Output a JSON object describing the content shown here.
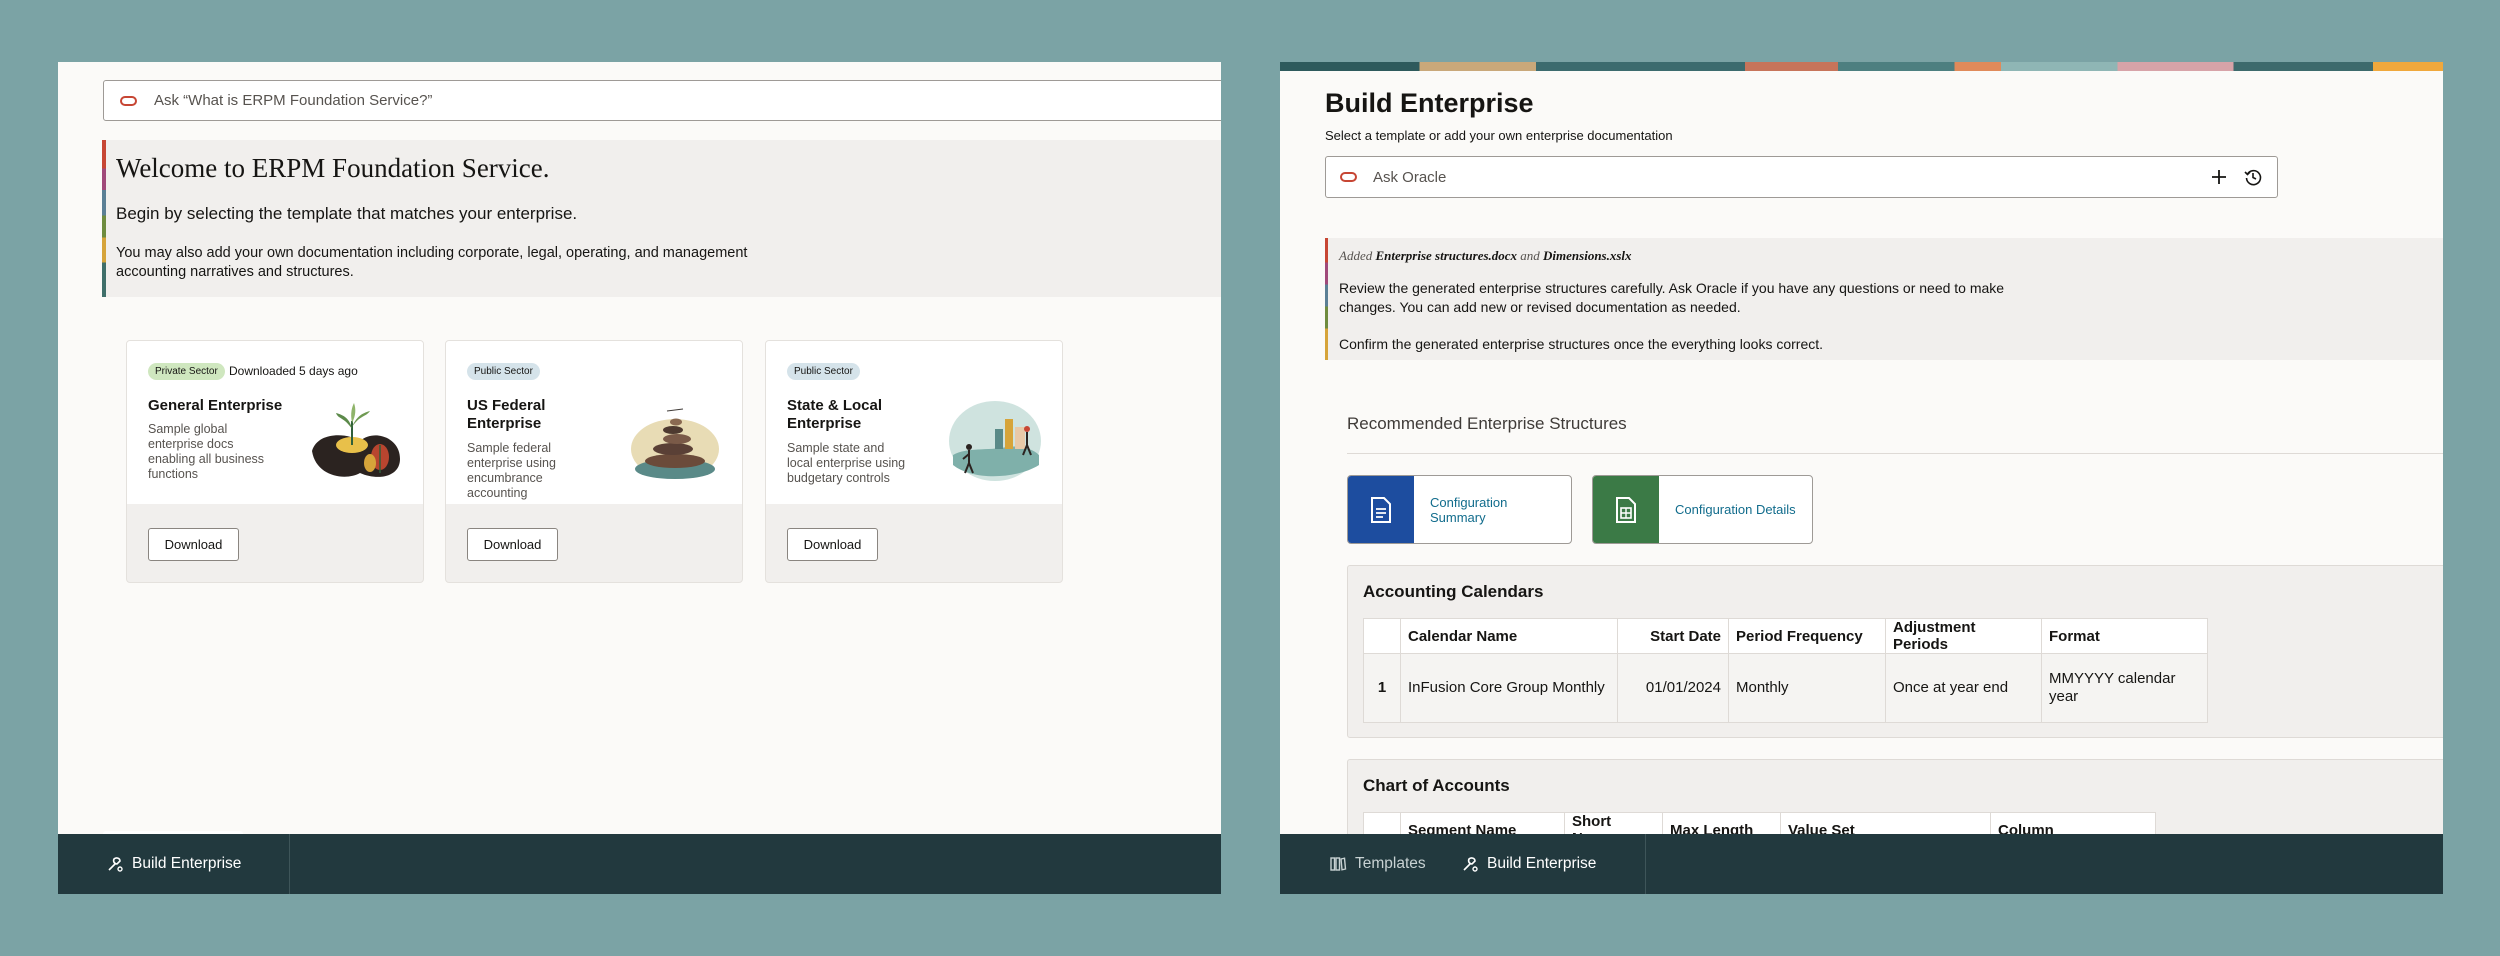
{
  "colors": {
    "background": "#7ba3a5",
    "footer": "#22393e",
    "oracle_red": "#c74634",
    "link": "#116c8c",
    "private_badge": "#cfe7bf",
    "public_badge": "#d5e3ea",
    "config_summary": "#1d4d9f",
    "config_details": "#3b7a46"
  },
  "left": {
    "ask": {
      "placeholder": "Ask “What is ERPM Foundation Service?”",
      "icon": "oracle-icon"
    },
    "welcome": {
      "title": "Welcome to ERPM Foundation Service.",
      "subtitle": "Begin by selecting the template that matches your enterprise.",
      "body": "You may also add your own documentation including corporate, legal, operating, and management accounting narratives and structures."
    },
    "cards": [
      {
        "badge": "Private Sector",
        "note": "Downloaded 5 days ago",
        "title": "General Enterprise",
        "description": "Sample global enterprise docs enabling all business functions",
        "button": "Download",
        "illustration": "plant-illustration"
      },
      {
        "badge": "Public Sector",
        "note": "",
        "title": "US Federal Enterprise",
        "description": "Sample federal enterprise using encumbrance accounting",
        "button": "Download",
        "illustration": "stacked-stones-illustration"
      },
      {
        "badge": "Public Sector",
        "note": "",
        "title": "State & Local Enterprise",
        "description": "Sample state and local enterprise using budgetary controls",
        "button": "Download",
        "illustration": "city-people-illustration"
      }
    ],
    "footer": {
      "build": "Build Enterprise"
    }
  },
  "right": {
    "title": "Build Enterprise",
    "subtitle": "Select a template or add your own enterprise documentation",
    "ask": {
      "placeholder": "Ask Oracle"
    },
    "notice": {
      "added_prefix": "Added",
      "file1": "Enterprise structures.docx",
      "and": "and",
      "file2": "Dimensions.xslx",
      "p1": "Review the generated enterprise structures carefully. Ask Oracle if you have any questions or need to make changes. You can add new or revised documentation as needed.",
      "p2": "Confirm the generated enterprise structures once the everything looks correct."
    },
    "recommended_title": "Recommended Enterprise Structures",
    "config": {
      "summary": "Configuration Summary",
      "details": "Configuration Details"
    },
    "calendars": {
      "title": "Accounting Calendars",
      "headers": [
        "Calendar Name",
        "Start Date",
        "Period Frequency",
        "Adjustment Periods",
        "Format"
      ],
      "rows": [
        {
          "index": "1",
          "name": "InFusion Core Group Monthly",
          "start": "01/01/2024",
          "frequency": "Monthly",
          "adjustment": "Once at year end",
          "format": "MMYYYY calendar year"
        }
      ]
    },
    "coa": {
      "title": "Chart of Accounts",
      "headers": [
        "Segment Name",
        "Short Name",
        "Max Length",
        "Value Set",
        "Column"
      ]
    },
    "footer": {
      "templates": "Templates",
      "build": "Build Enterprise"
    }
  }
}
